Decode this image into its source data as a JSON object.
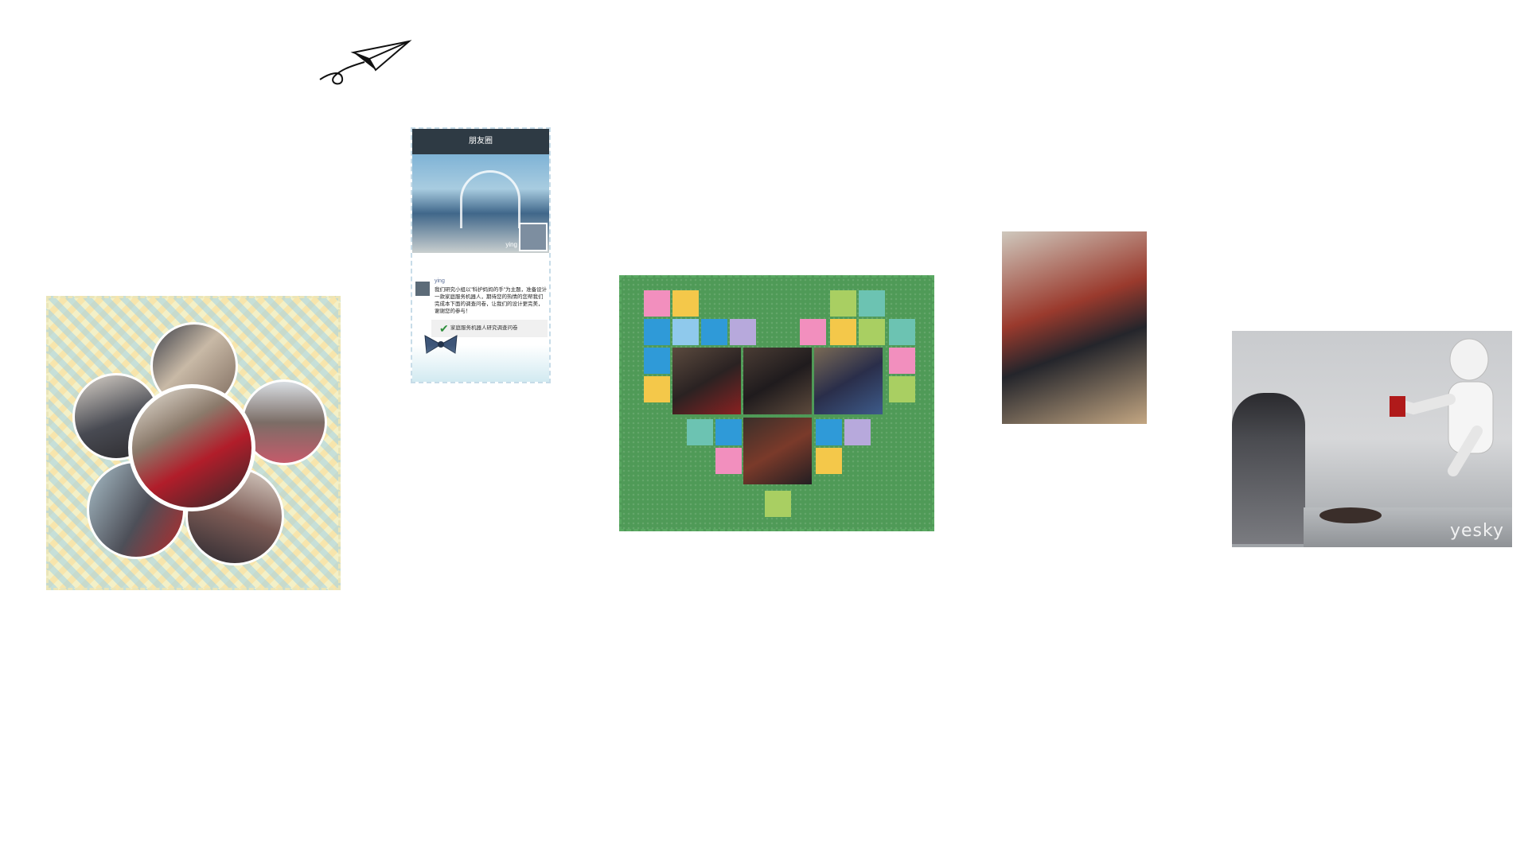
{
  "phone": {
    "header_title": "朋友圈",
    "cover_name": "ying",
    "post_name": "ying",
    "post_text": "我们研究小组以\"科护妈妈的手\"为主题，准备设计一款家庭服务机器人，期待您的热情的您帮我们完成本下面的调查问卷，让我们的设计更完美，谢谢您的参与！",
    "link_label": "家庭服务机器人研究调查问卷"
  },
  "robot_photo": {
    "watermark": "yesky"
  },
  "colors": {
    "background": "#ececec",
    "tile": "#ffffff",
    "heart_card": "#4f9a57",
    "heart_pink": "#f28fbe",
    "heart_yellow": "#f4c84a",
    "heart_blue": "#2f9ad8",
    "heart_lightblue": "#8fc9ec",
    "heart_teal": "#6cc3b2",
    "heart_lavender": "#b7a9dc",
    "heart_lime": "#a9cf62"
  },
  "icons": [
    "paper-plane-icon",
    "check-icon",
    "bow-icon"
  ]
}
